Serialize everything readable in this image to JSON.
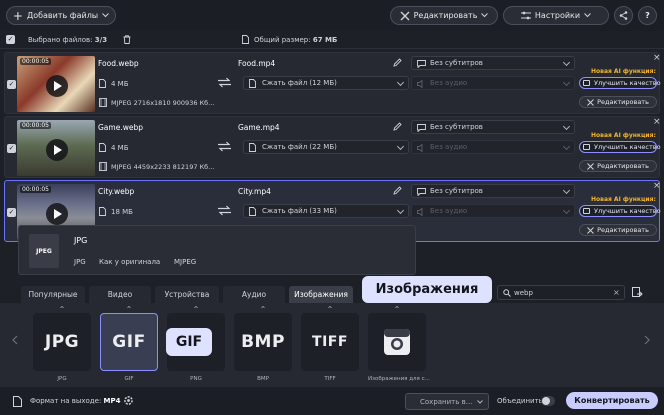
{
  "topbar": {
    "add_files": "Добавить файлы",
    "edit": "Редактировать",
    "settings": "Настройки"
  },
  "summary": {
    "selected_label": "Выбрано файлов:",
    "selected_count": "3/3",
    "total_label": "Общий размер:",
    "total_size": "67 МБ"
  },
  "files": [
    {
      "duration": "00:00:05",
      "name": "Food.webp",
      "size": "4 МБ",
      "meta": "MJPEG 2716x1810 900936 Кб...",
      "output_name": "Food.mp4",
      "compress": "Сжать файл (12 МБ)",
      "subtitles": "Без субтитров",
      "audio": "Без аудио",
      "ai_label": "Новая AI функция:",
      "enhance": "Улучшить качество",
      "edit": "Редактировать"
    },
    {
      "duration": "00:00:05",
      "name": "Game.webp",
      "size": "4 МБ",
      "meta": "MJPEG 4459x2233 812197 Кб...",
      "output_name": "Game.mp4",
      "compress": "Сжать файл (22 МБ)",
      "subtitles": "Без субтитров",
      "audio": "Без аудио",
      "ai_label": "Новая AI функция:",
      "enhance": "Улучшить качество",
      "edit": "Редактировать"
    },
    {
      "duration": "00:00:05",
      "name": "City.webp",
      "size": "18 МБ",
      "meta": "",
      "output_name": "City.mp4",
      "compress": "Сжать файл (33 МБ)",
      "subtitles": "Без субтитров",
      "audio": "Без аудио",
      "ai_label": "Новая AI функция:",
      "enhance": "Улучшить качество",
      "edit": "Редактировать"
    }
  ],
  "popup": {
    "format": "JPG",
    "icon_label": "JPEG",
    "details": [
      "JPG",
      "Как у оригинала",
      "MJPEG"
    ]
  },
  "tabs": [
    "Популярные",
    "Видео",
    "Устройства",
    "Аудио",
    "Изображения"
  ],
  "active_tab": "Изображения",
  "tab_tooltip": "Изображения",
  "search": {
    "value": "webp"
  },
  "formats": [
    {
      "logo": "JPG",
      "label": "JPG"
    },
    {
      "logo": "GIF",
      "label": "GIF"
    },
    {
      "logo": "",
      "label": "PNG"
    },
    {
      "logo": "BMP",
      "label": "BMP"
    },
    {
      "logo": "TIFF",
      "label": "TIFF"
    },
    {
      "logo": "",
      "label": "Изображения для с..."
    }
  ],
  "format_tooltip": "GIF",
  "bottombar": {
    "output_label": "Формат на выходе:",
    "output_value": "MP4",
    "save_to": "Сохранить в...",
    "merge": "Объединить:",
    "convert": "Конвертировать"
  },
  "colors": {
    "accent": "#8a90ff",
    "ai_label": "#f2b630",
    "convert_button": "#c9ccff"
  }
}
